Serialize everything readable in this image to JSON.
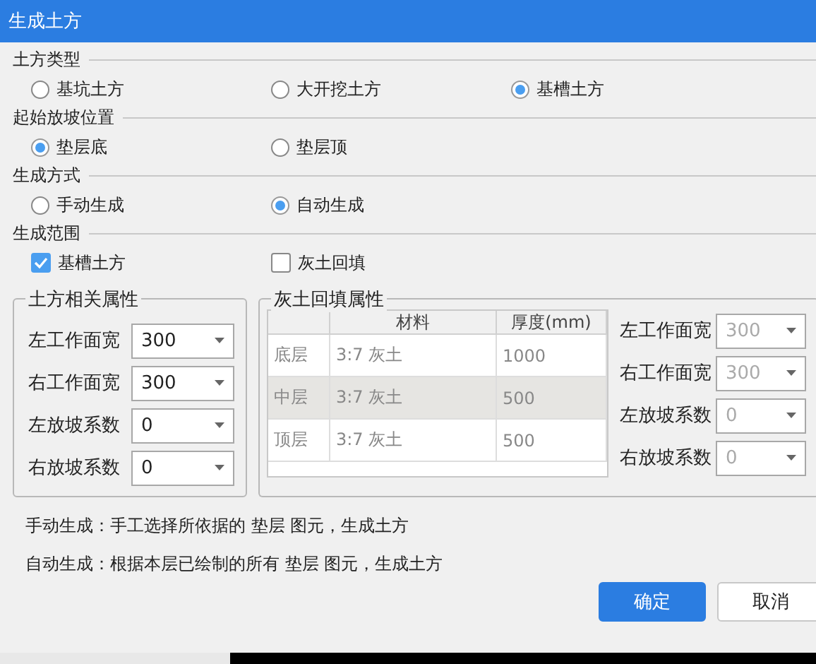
{
  "window": {
    "title": "生成土方"
  },
  "sections": [
    {
      "title": "土方类型",
      "kind": "radio",
      "options": [
        {
          "label": "基坑土方",
          "selected": false
        },
        {
          "label": "大开挖土方",
          "selected": false
        },
        {
          "label": "基槽土方",
          "selected": true
        }
      ]
    },
    {
      "title": "起始放坡位置",
      "kind": "radio",
      "options": [
        {
          "label": "垫层底",
          "selected": true
        },
        {
          "label": "垫层顶",
          "selected": false
        }
      ]
    },
    {
      "title": "生成方式",
      "kind": "radio",
      "options": [
        {
          "label": "手动生成",
          "selected": false
        },
        {
          "label": "自动生成",
          "selected": true
        }
      ]
    },
    {
      "title": "生成范围",
      "kind": "checkbox",
      "options": [
        {
          "label": "基槽土方",
          "checked": true
        },
        {
          "label": "灰土回填",
          "checked": false
        }
      ]
    }
  ],
  "earthwork_properties": {
    "title": "土方相关属性",
    "fields": [
      {
        "label": "左工作面宽",
        "value": "300",
        "disabled": false
      },
      {
        "label": "右工作面宽",
        "value": "300",
        "disabled": false
      },
      {
        "label": "左放坡系数",
        "value": "0",
        "disabled": false
      },
      {
        "label": "右放坡系数",
        "value": "0",
        "disabled": false
      }
    ]
  },
  "backfill_properties": {
    "title": "灰土回填属性",
    "table": {
      "columns": [
        "材料",
        "厚度(mm)"
      ],
      "rows": [
        {
          "header": "底层",
          "material": "3:7 灰土",
          "thickness": "1000",
          "selected": false
        },
        {
          "header": "中层",
          "material": "3:7 灰土",
          "thickness": "500",
          "selected": true
        },
        {
          "header": "顶层",
          "material": "3:7 灰土",
          "thickness": "500",
          "selected": false
        }
      ]
    },
    "fields": [
      {
        "label": "左工作面宽",
        "value": "300",
        "disabled": true
      },
      {
        "label": "右工作面宽",
        "value": "300",
        "disabled": true
      },
      {
        "label": "左放坡系数",
        "value": "0",
        "disabled": true
      },
      {
        "label": "右放坡系数",
        "value": "0",
        "disabled": true
      }
    ]
  },
  "notes": [
    "手动生成：手工选择所依据的 垫层 图元，生成土方",
    "自动生成：根据本层已绘制的所有 垫层 图元，生成土方"
  ],
  "buttons": [
    {
      "label": "确定",
      "kind": "primary"
    },
    {
      "label": "取消",
      "kind": "secondary"
    }
  ]
}
